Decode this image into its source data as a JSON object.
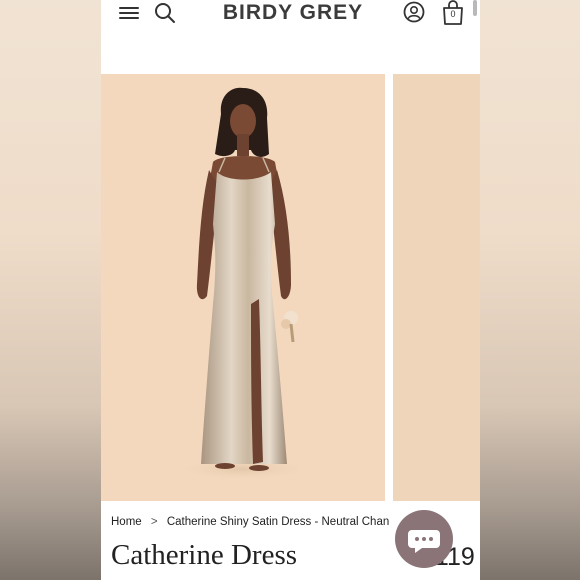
{
  "header": {
    "logo": "BIRDY GREY",
    "cart_count": "0"
  },
  "breadcrumb": {
    "home": "Home",
    "separator": ">",
    "current": "Catherine Shiny Satin Dress - Neutral Chan"
  },
  "product": {
    "title": "Catherine Dress",
    "price": "$119"
  },
  "icons": [
    "menu-icon",
    "search-icon",
    "account-icon",
    "cart-icon",
    "chat-icon"
  ],
  "colors": {
    "background": "#f3d8bd",
    "dress": "#c9b8a3",
    "chat": "#8a7478",
    "text": "#222222"
  }
}
